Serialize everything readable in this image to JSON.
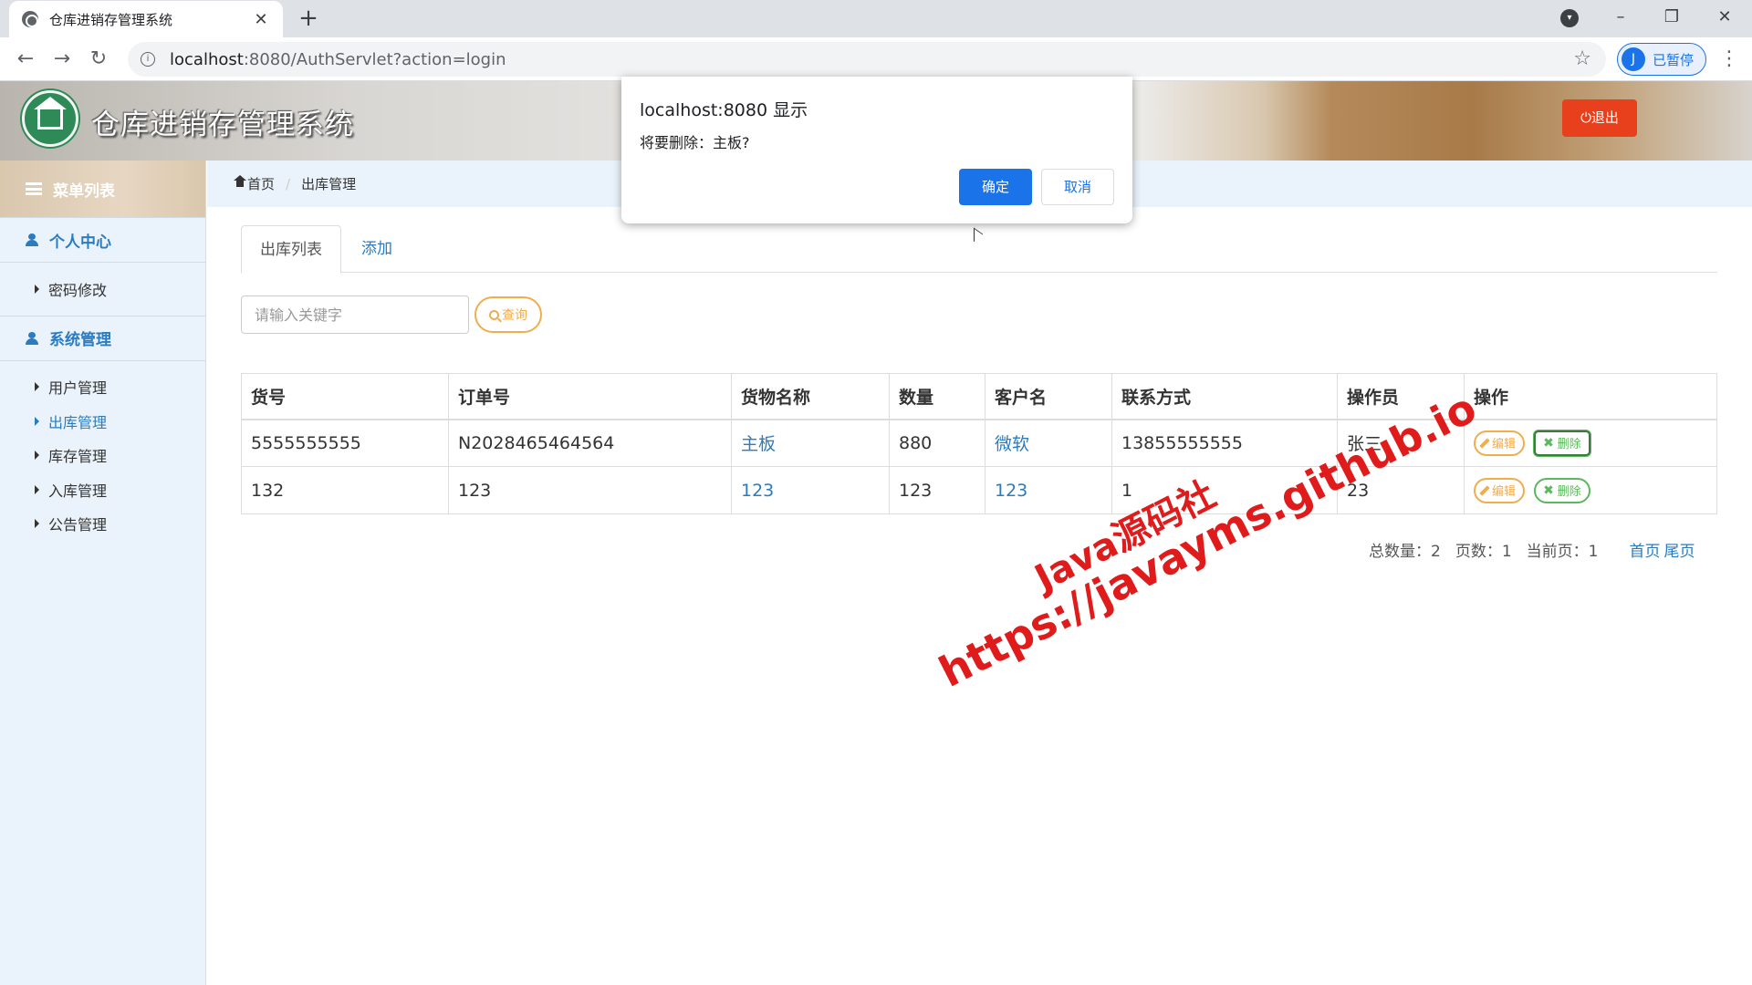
{
  "browser": {
    "tab_title": "仓库进销存管理系统",
    "tab_close": "✕",
    "new_tab": "+",
    "url_host": "localhost",
    "url_path": ":8080/AuthServlet?action=login",
    "profile_initial": "J",
    "profile_status": "已暂停",
    "icons": [
      "back-icon",
      "forward-icon",
      "reload-icon",
      "info-icon",
      "star-icon",
      "minimize-icon",
      "restore-icon",
      "close-icon",
      "menu-icon"
    ]
  },
  "header": {
    "title": "仓库进销存管理系统",
    "logout_label": "⏻退出"
  },
  "sidebar": {
    "menu_title": "菜单列表",
    "groups": [
      {
        "label": "个人中心",
        "items": [
          "密码修改"
        ]
      },
      {
        "label": "系统管理",
        "items": [
          "用户管理",
          "出库管理",
          "库存管理",
          "入库管理",
          "公告管理"
        ]
      }
    ],
    "active_item": "出库管理"
  },
  "breadcrumb": {
    "home": "首页",
    "current": "出库管理"
  },
  "tabs": {
    "list": "出库列表",
    "add": "添加"
  },
  "search": {
    "placeholder": "请输入关键字",
    "button": "查询"
  },
  "table": {
    "headers": [
      "货号",
      "订单号",
      "货物名称",
      "数量",
      "客户名",
      "联系方式",
      "操作员",
      "操作"
    ],
    "rows": [
      [
        "5555555555",
        "N2028465464564",
        "主板",
        "880",
        "微软",
        "13855555555",
        "张三"
      ],
      [
        "132",
        "123",
        "123",
        "123",
        "123",
        "1",
        "23"
      ]
    ],
    "edit_label": "编辑",
    "delete_label": "删除"
  },
  "pager": {
    "total": "总数量：2",
    "pages": "页数：1",
    "current": "当前页：1",
    "first": "首页",
    "last": "尾页"
  },
  "watermark": {
    "line1": "Java源码社",
    "line2": "https://javayms.github.io"
  },
  "dialog": {
    "title": "localhost:8080 显示",
    "message": "将要删除：主板?",
    "ok": "确定",
    "cancel": "取消"
  },
  "colors": {
    "accent": "#2a7bbf",
    "danger": "#e8401c",
    "warning": "#f0ad4e",
    "success": "#5cb85c",
    "dialog_primary": "#1a73e8"
  }
}
